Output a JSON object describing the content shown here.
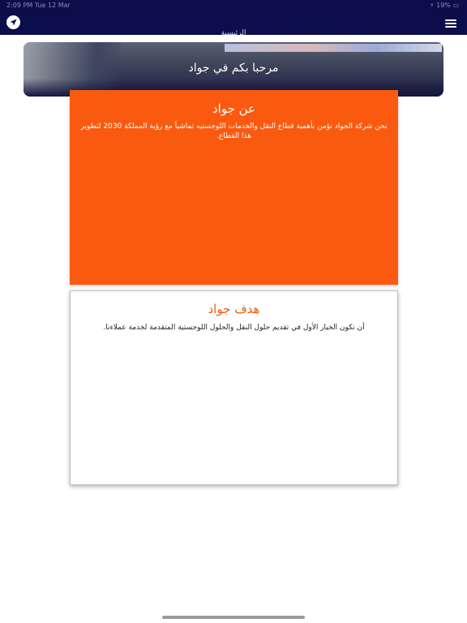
{
  "status_bar": {
    "left": "2:09 PM   Tue 12 Mar",
    "right": "⚡ 19% ▭"
  },
  "header": {
    "title": "الرئيسية"
  },
  "banner": {
    "welcome": "مرحبا بكم في جواد"
  },
  "about": {
    "title": "عن جواد",
    "body": "نحن شركة الجواد نؤمن بأهمية قطاع النقل والخدمات اللوجستيه تماشياً مع رؤية المملكة 2030 لتطوير هذا القطاع."
  },
  "goal": {
    "title": "هدف جواد",
    "body": "أن نكون الخيار الأول في تقديم حلول النقل والحلول اللوجستية المتقدمة لخدمة عملاءنا."
  },
  "colors": {
    "header_bg": "#0b0e4a",
    "accent": "#fa5a10"
  },
  "icons": {
    "nav": "navigation-arrow-icon",
    "menu": "hamburger-menu-icon"
  }
}
